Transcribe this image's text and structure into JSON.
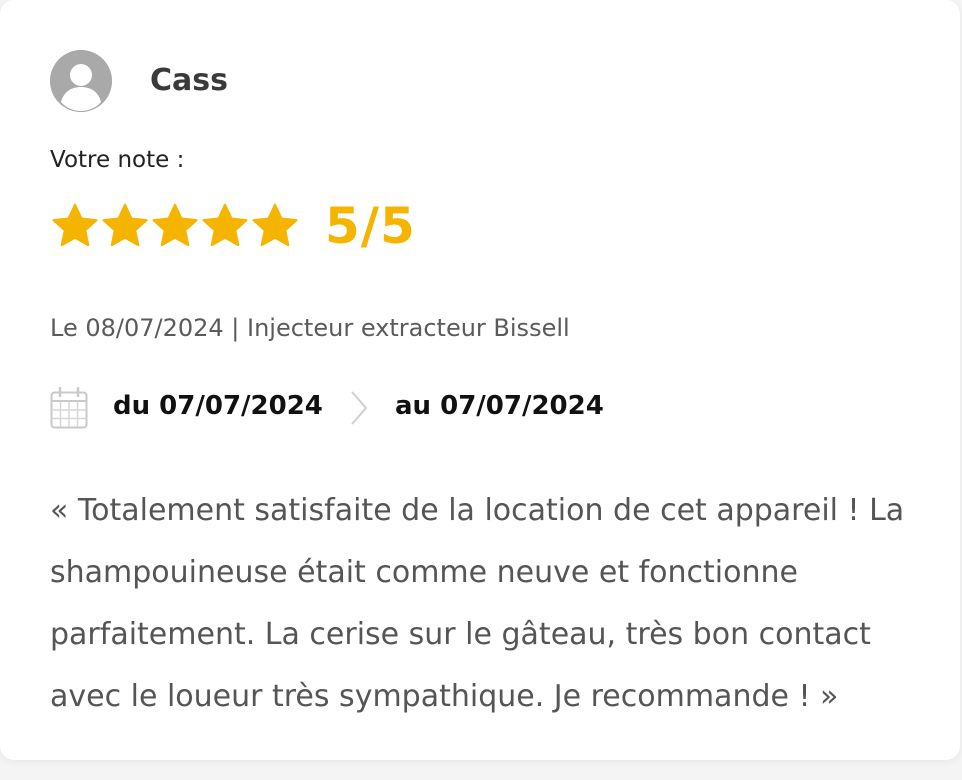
{
  "reviewer": {
    "name": "Cass",
    "avatar_icon": "user-placeholder-icon"
  },
  "rating": {
    "label": "Votre note :",
    "stars": 5,
    "max": 5,
    "score_text": "5/5",
    "star_color": "#f5b400"
  },
  "meta": {
    "text": "Le 08/07/2024 | Injecteur extracteur Bissell"
  },
  "period": {
    "icon": "calendar-icon",
    "from": "du 07/07/2024",
    "separator_icon": "chevron-right-icon",
    "to": "au 07/07/2024"
  },
  "review": {
    "text": "« Totalement satisfaite de la location de cet appareil ! La shampouineuse était comme neuve et fonctionne parfaitement. La cerise sur le gâteau, très bon contact avec le loueur très sympathique. Je recommande ! »"
  }
}
